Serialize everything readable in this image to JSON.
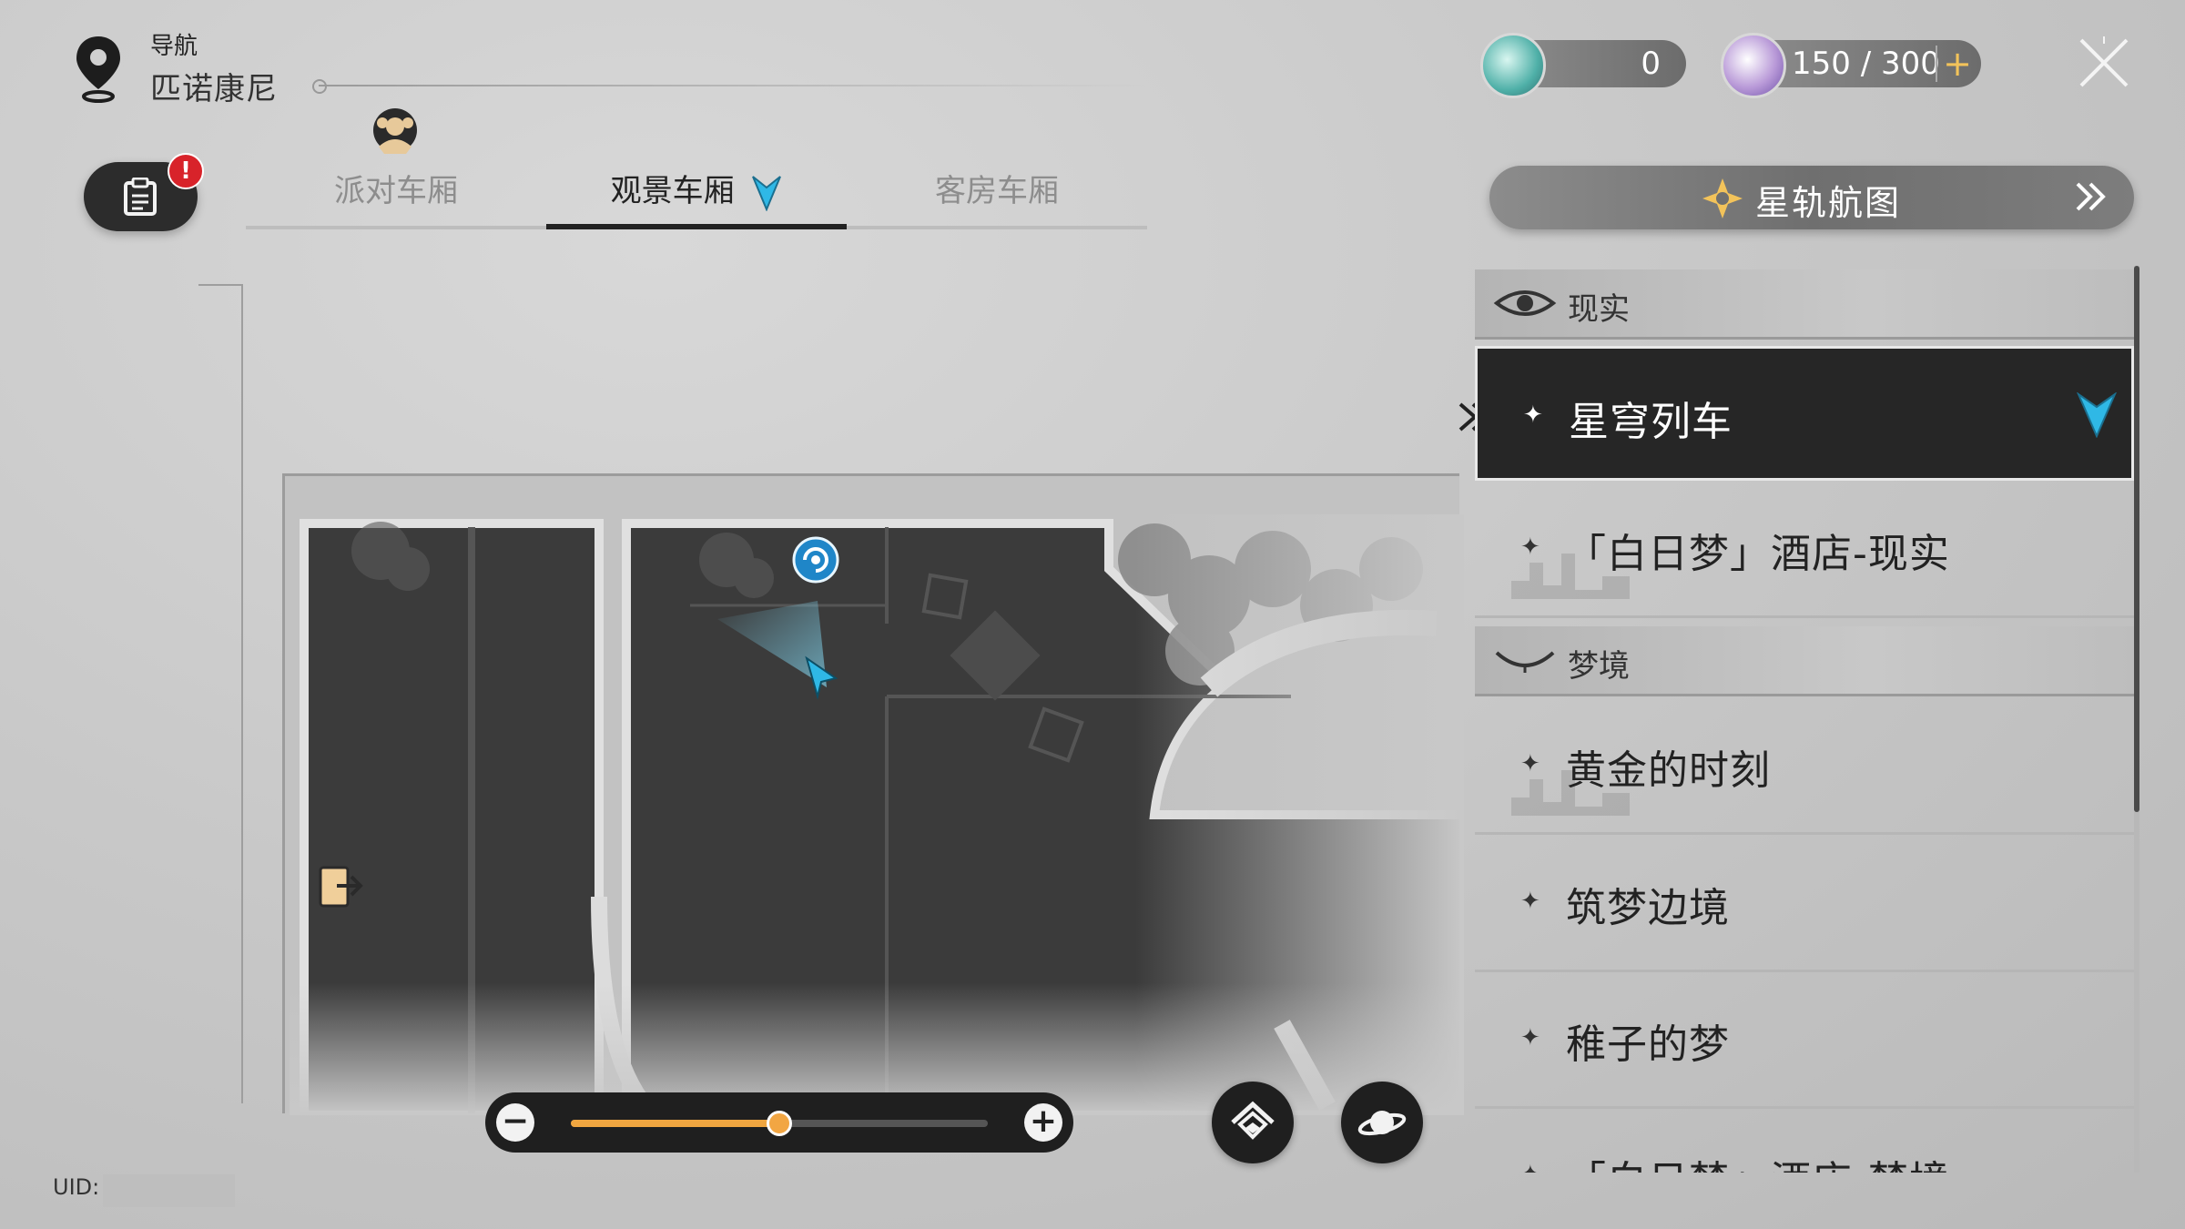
{
  "nav": {
    "label": "导航",
    "location": "匹诺康尼"
  },
  "mission": {
    "alert": "!"
  },
  "tabs": [
    {
      "label": "派对车厢",
      "active": false
    },
    {
      "label": "观景车厢",
      "active": true
    },
    {
      "label": "客房车厢",
      "active": false
    }
  ],
  "currency": {
    "first": {
      "icon": "stellar-jade-icon",
      "value": "0"
    },
    "second": {
      "icon": "trailblaze-power-icon",
      "value": "150 / 300",
      "plus": "+"
    }
  },
  "star_rail_map": {
    "label": "星轨航图"
  },
  "panel": {
    "section_reality": "现实",
    "reality_items": [
      {
        "label": "星穹列车",
        "selected": true
      },
      {
        "label": "「白日梦」酒店-现实",
        "selected": false
      }
    ],
    "section_dream": "梦境",
    "dream_items": [
      {
        "label": "黄金的时刻"
      },
      {
        "label": "筑梦边境"
      },
      {
        "label": "稚子的梦"
      },
      {
        "label": "「白日梦」酒店-梦境"
      }
    ]
  },
  "zoom": {
    "minus": "−",
    "plus": "+",
    "level": 0.5
  },
  "uid": {
    "label": "UID:"
  },
  "colors": {
    "accent": "#2fb8e6",
    "zoom_fill": "#f0a640",
    "panel_dark": "#262626"
  }
}
